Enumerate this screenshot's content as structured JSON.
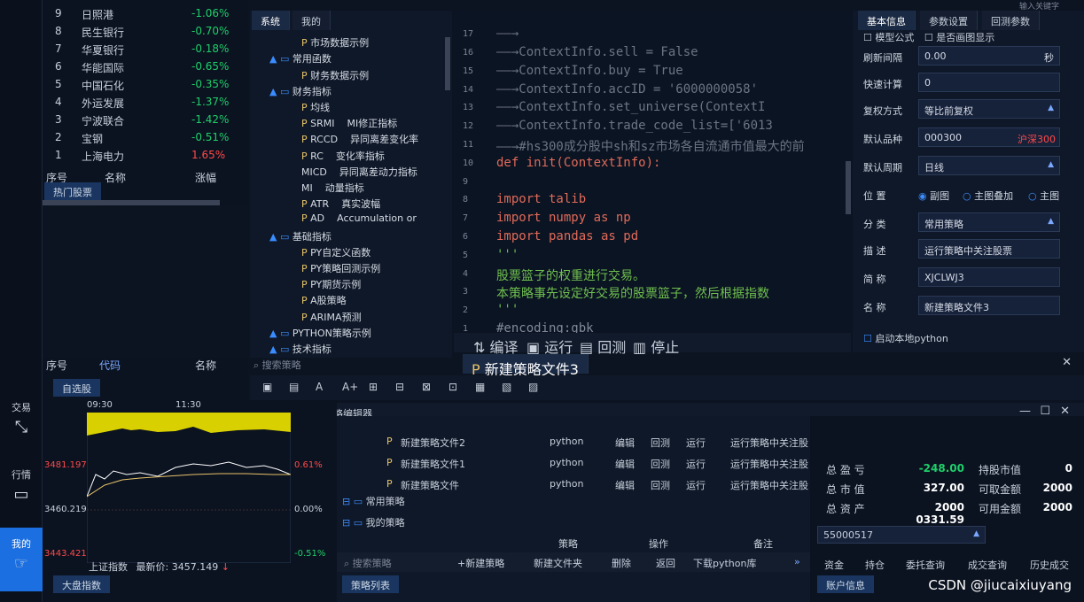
{
  "watermark": "CSDN @jiucaixiuyang",
  "iconbar": {
    "items": [
      {
        "label": "交易",
        "icon": "arrow-icon"
      },
      {
        "label": "行情",
        "icon": "chart-icon"
      },
      {
        "label": "我的",
        "icon": "hand-icon"
      }
    ]
  },
  "watch": {
    "header": [
      "序号",
      "名称",
      "涨幅"
    ],
    "rows": [
      {
        "no": "1",
        "name": "上海电力",
        "chg": "1.65%"
      },
      {
        "no": "2",
        "name": "宝钢",
        "chg": "-0.51%"
      },
      {
        "no": "3",
        "name": "宁波联合",
        "chg": "-1.42%"
      },
      {
        "no": "4",
        "name": "外运发展",
        "chg": "-1.37%"
      },
      {
        "no": "5",
        "name": "中国石化",
        "chg": "-0.35%"
      },
      {
        "no": "6",
        "name": "华能国际",
        "chg": "-0.65%"
      },
      {
        "no": "7",
        "name": "华夏银行",
        "chg": "-0.18%"
      },
      {
        "no": "8",
        "name": "民生银行",
        "chg": "-0.70%"
      },
      {
        "no": "9",
        "name": "日照港",
        "chg": "-1.06%"
      }
    ],
    "tab": "热门股票",
    "tab2": "自选股",
    "header2": [
      "序号",
      "代码",
      "名称"
    ]
  },
  "tree": {
    "tabs": [
      "系统",
      "我的"
    ],
    "search_placeholder": "搜索策略",
    "items": [
      {
        "kind": "folder",
        "text": "技术指标"
      },
      {
        "kind": "folder",
        "text": "PYTHON策略示例"
      },
      {
        "kind": "file",
        "text": "ARIMA预测"
      },
      {
        "kind": "file",
        "text": "A股策略"
      },
      {
        "kind": "file",
        "text": "PY期货示例"
      },
      {
        "kind": "file",
        "text": "PY策略回测示例"
      },
      {
        "kind": "file",
        "text": "PY自定义函数"
      },
      {
        "kind": "folder",
        "text": "基础指标"
      },
      {
        "kind": "file",
        "text": "AD",
        "desc": "Accumulation or"
      },
      {
        "kind": "file",
        "text": "ATR",
        "desc": "真实波幅"
      },
      {
        "kind": "plain",
        "text": "MI",
        "desc": "动量指标"
      },
      {
        "kind": "plain",
        "text": "MICD",
        "desc": "异同离差动力指标"
      },
      {
        "kind": "file",
        "text": "RC",
        "desc": "变化率指标"
      },
      {
        "kind": "file",
        "text": "RCCD",
        "desc": "异同离差变化率"
      },
      {
        "kind": "file",
        "text": "SRMI",
        "desc": "MI修正指标"
      },
      {
        "kind": "file",
        "text": "均线"
      },
      {
        "kind": "folder",
        "text": "财务指标"
      },
      {
        "kind": "file",
        "text": "财务数据示例"
      },
      {
        "kind": "folder",
        "text": "常用函数"
      },
      {
        "kind": "file",
        "text": "市场数据示例"
      }
    ]
  },
  "code": {
    "lines": [
      {
        "n": "1",
        "t": "#encoding:gbk",
        "c": "grey"
      },
      {
        "n": "2",
        "t": "'''",
        "c": "cm"
      },
      {
        "n": "3",
        "t": "本策略事先设定好交易的股票篮子，然后根据指数",
        "c": "cm"
      },
      {
        "n": "4",
        "t": "股票篮子的权重进行交易。",
        "c": "cm"
      },
      {
        "n": "5",
        "t": "'''",
        "c": "cm"
      },
      {
        "n": "6",
        "t": "import pandas as pd",
        "c": "kw"
      },
      {
        "n": "7",
        "t": "import numpy as np",
        "c": "kw"
      },
      {
        "n": "8",
        "t": "import talib",
        "c": "kw"
      },
      {
        "n": "9",
        "t": "",
        "c": "code"
      },
      {
        "n": "10",
        "t": "def init(ContextInfo):",
        "c": "kw"
      },
      {
        "n": "11",
        "t": "——→#hs300成分股中sh和sz市场各自流通市值最大的前",
        "c": "arrow"
      },
      {
        "n": "12",
        "t": "——→ContextInfo.trade_code_list=['6013",
        "c": "arrow"
      },
      {
        "n": "13",
        "t": "——→ContextInfo.set_universe(ContextI",
        "c": "arrow"
      },
      {
        "n": "14",
        "t": "——→ContextInfo.accID = '6000000058'",
        "c": "arrow"
      },
      {
        "n": "15",
        "t": "——→ContextInfo.buy = True",
        "c": "arrow"
      },
      {
        "n": "16",
        "t": "——→ContextInfo.sell = False",
        "c": "arrow"
      },
      {
        "n": "17",
        "t": "——→",
        "c": "arrow"
      }
    ],
    "toolbar": [
      "编译",
      "运行",
      "回测",
      "停止"
    ],
    "file_tab": "新建策略文件3"
  },
  "props": {
    "tabs": [
      "基本信息",
      "参数设置",
      "回测参数"
    ],
    "fields": [
      {
        "label": "名    称",
        "value": "新建策略文件3"
      },
      {
        "label": "简    称",
        "value": "XJCLWJ3"
      },
      {
        "label": "描    述",
        "value": "运行策略中关注股票"
      },
      {
        "label": "分    类",
        "value": "常用策略",
        "dropdown": true
      },
      {
        "label": "默认周期",
        "value": "日线",
        "dropdown": true
      },
      {
        "label": "默认品种",
        "value": "000300",
        "extra": "沪深300"
      },
      {
        "label": "复权方式",
        "value": "等比前复权",
        "dropdown": true
      },
      {
        "label": "快速计算",
        "value": "0"
      },
      {
        "label": "刷新间隔",
        "value": "0.00",
        "unit": "秒"
      }
    ],
    "position": {
      "label": "位    置",
      "options": [
        "副图",
        "主图叠加",
        "主图"
      ]
    },
    "python_check": "启动本地python",
    "top_checks": [
      "模型公式",
      "是否画图显示"
    ],
    "search_hint": "输入关键字"
  },
  "window_title": "新建策略文件3-策略编辑器",
  "editor_buttons": [
    "save",
    "save-all",
    "font-a",
    "font-a-plus",
    "b1",
    "b2",
    "b3",
    "b4",
    "b5",
    "b6",
    "b7"
  ],
  "chart": {
    "time_ticks": [
      "09:30",
      "11:30"
    ],
    "left_labels": [
      "3481.197",
      "3460.219"
    ],
    "right_labels": [
      "0.61%",
      "0.00%"
    ],
    "bottom_left": "3443.421",
    "bottom_right": "-0.51%",
    "info_index": "上证指数",
    "info_latest_label": "最新价:",
    "info_latest_value": "3457.149",
    "tab": "大盘指数"
  },
  "strategies": {
    "rows": [
      {
        "name": "新建策略文件2",
        "lang": "python",
        "a": "编辑",
        "b": "回测",
        "c": "运行",
        "desc": "运行策略中关注股票"
      },
      {
        "name": "新建策略文件1",
        "lang": "python",
        "a": "编辑",
        "b": "回测",
        "c": "运行",
        "desc": "运行策略中关注股票"
      },
      {
        "name": "新建策略文件",
        "lang": "python",
        "a": "编辑",
        "b": "回测",
        "c": "运行",
        "desc": "运行策略中关注股票"
      }
    ],
    "groups": [
      "常用策略",
      "我的策略"
    ],
    "header": [
      "策略",
      "操作",
      "备注"
    ],
    "actions": [
      "+新建策略",
      "新建文件夹",
      "删除",
      "返回",
      "下载python库"
    ],
    "search_placeholder": "搜索策略",
    "tab": "策略列表"
  },
  "account": {
    "rows": [
      {
        "l1": "总 盈 亏",
        "v1": "-248.00",
        "l2": "持股市值",
        "v2": "0"
      },
      {
        "l1": "总 市 值",
        "v1": "327.00",
        "l2": "可取金额",
        "v2": "2000"
      },
      {
        "l1": "总 资 产",
        "v1": "2000 0331.59",
        "l2": "可用金额",
        "v2": "2000"
      }
    ],
    "account_id": "55000517",
    "tabs": [
      "资金",
      "持仓",
      "委托查询",
      "成交查询",
      "历史成交"
    ],
    "bottom_tab": "账户信息"
  }
}
